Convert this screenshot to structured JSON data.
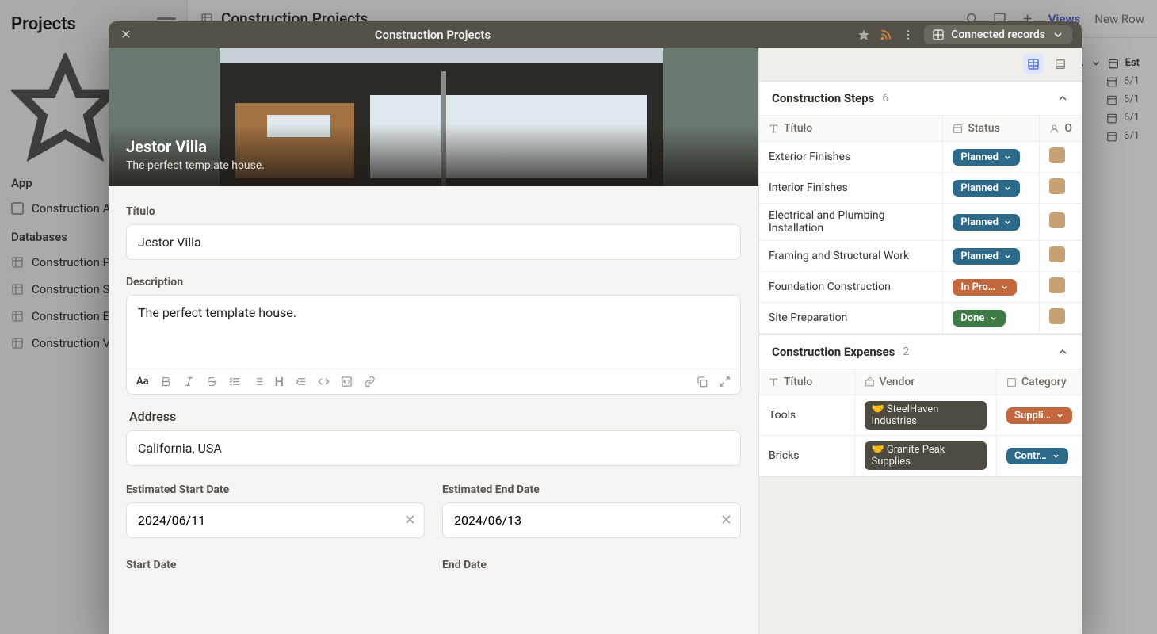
{
  "sidebar": {
    "title": "Projects",
    "favorites_label": "Favorites",
    "app_label": "App",
    "app_item": "Construction A",
    "databases_label": "Databases",
    "db_items": [
      "Construction P",
      "Construction S",
      "Construction E",
      "Construction V"
    ]
  },
  "topbar": {
    "title": "Construction Projects",
    "views": "Views",
    "new_row": "New Row",
    "est_col": "Est",
    "row_dates": [
      "6/1",
      "6/1",
      "6/1",
      "6/1"
    ]
  },
  "modal": {
    "title": "Construction Projects",
    "connected": "Connected records"
  },
  "record": {
    "name": "Jestor Villa",
    "subtitle": "The perfect template house.",
    "fields": {
      "titulo_label": "Título",
      "titulo_value": "Jestor Villa",
      "description_label": "Description",
      "description_value": "The perfect template house.",
      "address_label": "Address",
      "address_value": "California, USA",
      "est_start_label": "Estimated Start Date",
      "est_start_value": "2024/06/11",
      "est_end_label": "Estimated End Date",
      "est_end_value": "2024/06/13",
      "start_label": "Start Date",
      "end_label": "End Date"
    }
  },
  "steps": {
    "title": "Construction Steps",
    "count": "6",
    "cols": {
      "titulo": "Título",
      "status": "Status",
      "owner": "O"
    },
    "rows": [
      {
        "t": "Exterior Finishes",
        "s": "Planned",
        "c": "b-blue"
      },
      {
        "t": "Interior Finishes",
        "s": "Planned",
        "c": "b-blue"
      },
      {
        "t": "Electrical and Plumbing Installation",
        "s": "Planned",
        "c": "b-blue"
      },
      {
        "t": "Framing and Structural Work",
        "s": "Planned",
        "c": "b-blue"
      },
      {
        "t": "Foundation Construction",
        "s": "In Pro…",
        "c": "b-orange"
      },
      {
        "t": "Site Preparation",
        "s": "Done",
        "c": "b-green"
      }
    ]
  },
  "expenses": {
    "title": "Construction Expenses",
    "count": "2",
    "cols": {
      "titulo": "Título",
      "vendor": "Vendor",
      "category": "Category"
    },
    "rows": [
      {
        "t": "Tools",
        "v": "SteelHaven Industries",
        "cat": "Suppli…",
        "cc": "cat-sup"
      },
      {
        "t": "Bricks",
        "v": "Granite Peak Supplies",
        "cat": "Contr…",
        "cc": "cat-con"
      }
    ]
  }
}
